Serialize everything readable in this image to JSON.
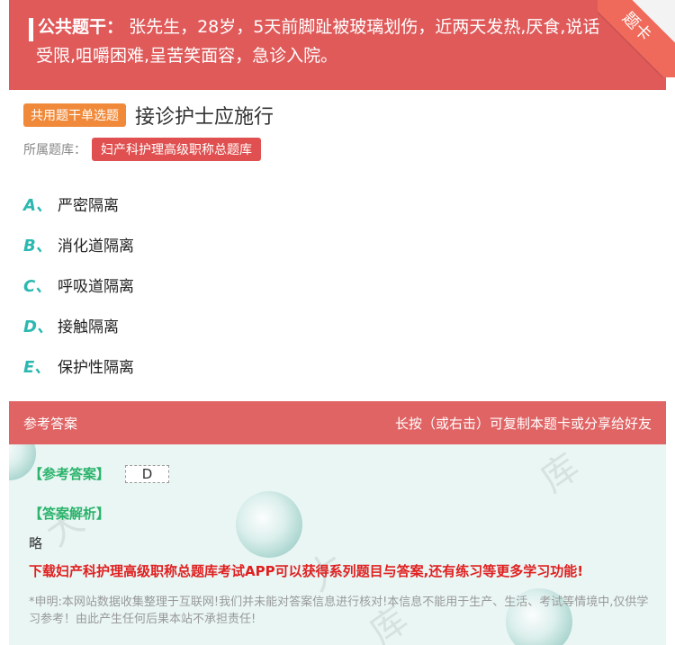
{
  "stem": {
    "label": "公共题干：",
    "text": "张先生，28岁，5天前脚趾被玻璃划伤，近两天发热,厌食,说话受限,咀嚼困难,呈苦笑面容，急诊入院。",
    "corner_label": "题卡"
  },
  "question": {
    "type_tag": "共用题干单选题",
    "text": "接诊护士应施行"
  },
  "bank": {
    "label": "所属题库：",
    "name": "妇产科护理高级职称总题库"
  },
  "options": [
    {
      "letter": "A、",
      "text": "严密隔离"
    },
    {
      "letter": "B、",
      "text": "消化道隔离"
    },
    {
      "letter": "C、",
      "text": "呼吸道隔离"
    },
    {
      "letter": "D、",
      "text": "接触隔离"
    },
    {
      "letter": "E、",
      "text": "保护性隔离"
    }
  ],
  "answer_bar": {
    "title": "参考答案",
    "hint": "长按（或右击）可复制本题卡或分享给好友"
  },
  "answer": {
    "answer_label": "【参考答案】",
    "answer_value": "D",
    "analysis_label": "【答案解析】",
    "analysis_text": "略",
    "download_text": "下载妇产科护理高级职称总题库考试APP可以获得系列题目与答案,还有练习等更多学习功能!",
    "disclaimer": "*申明:本网站数据收集整理于互联网!我们并未能对答案信息进行核对!本信息不能用于生产、生活、考试等情境中,仅供学习参考！由此产生任何后果本站不承担责任!"
  },
  "colors": {
    "stem_bg": "#e05a5a",
    "tag_orange": "#f08a3a",
    "bank_red": "#e05050",
    "option_letter": "#2bb8b0",
    "answer_label_green": "#2bb36b",
    "download_red": "#e02020"
  }
}
